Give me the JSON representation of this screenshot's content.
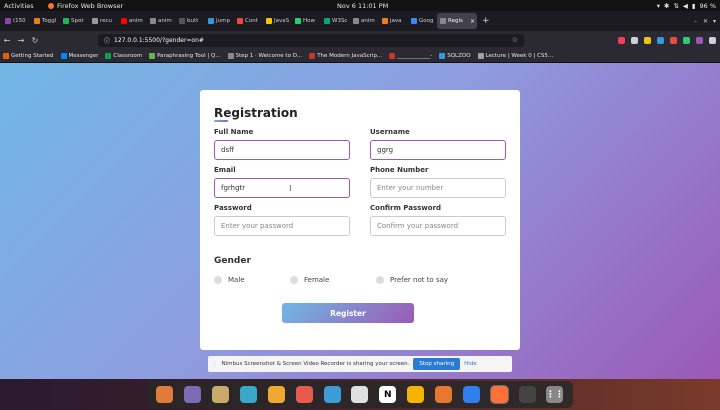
{
  "system_bar": {
    "activities": "Activities",
    "app_name": "Firefox Web Browser",
    "clock": "Nov 6  11:01 PM",
    "battery": "96 %"
  },
  "tabs": [
    {
      "label": "(150",
      "color": "#8e44ad"
    },
    {
      "label": "Toggl",
      "color": "#e67e22"
    },
    {
      "label": "Spot",
      "color": "#1db954"
    },
    {
      "label": "recu",
      "color": "#999999"
    },
    {
      "label": "anim",
      "color": "#ff0000"
    },
    {
      "label": "anim",
      "color": "#888888"
    },
    {
      "label": "butt",
      "color": "#555555"
    },
    {
      "label": "Jump",
      "color": "#3498db"
    },
    {
      "label": "Cont",
      "color": "#e74c3c"
    },
    {
      "label": "JavaS",
      "color": "#f1c40f"
    },
    {
      "label": "How",
      "color": "#2ecc71"
    },
    {
      "label": "W3Sc",
      "color": "#04aa6d"
    },
    {
      "label": "anim",
      "color": "#888888"
    },
    {
      "label": "java",
      "color": "#e67e22"
    },
    {
      "label": "Goog",
      "color": "#4285f4"
    }
  ],
  "active_tab": {
    "label": "Regis",
    "close": "×"
  },
  "url": "127.0.0.1:5500/?gender=on#",
  "bookmarks": [
    {
      "label": "Getting Started",
      "color": "#e66000"
    },
    {
      "label": "Messenger",
      "color": "#0084ff"
    },
    {
      "label": "Classroom",
      "color": "#0f9d58"
    },
    {
      "label": "Paraphrasing Tool | Q...",
      "color": "#6ab04c"
    },
    {
      "label": "Step 1 · Welcome to D...",
      "color": "#888888"
    },
    {
      "label": "The Modern JavaScrip...",
      "color": "#c0392b"
    },
    {
      "label": "____________-",
      "color": "#c0392b"
    },
    {
      "label": "SQLZOO",
      "color": "#3498db"
    },
    {
      "label": "Lecture | Week 0 | CS5...",
      "color": "#a0a0a0"
    }
  ],
  "form": {
    "title": "Registration",
    "full_name": {
      "label": "Full Name",
      "value": "dsff"
    },
    "username": {
      "label": "Username",
      "value": "ggrg"
    },
    "email": {
      "label": "Email",
      "value": "fgrhgtr"
    },
    "phone": {
      "label": "Phone Number",
      "placeholder": "Enter your number"
    },
    "password": {
      "label": "Password",
      "placeholder": "Enter your password"
    },
    "confirm_password": {
      "label": "Confirm Password",
      "placeholder": "Confirm your password"
    },
    "gender_title": "Gender",
    "gender_options": [
      "Male",
      "Female",
      "Prefer not to say"
    ],
    "register_label": "Register"
  },
  "share_notice": {
    "text": "Nimbus Screenshot & Screen Video Recorder is sharing your screen.",
    "stop": "Stop sharing",
    "hide": "Hide"
  },
  "dock": [
    {
      "icon": "screenshot-app-icon",
      "color": "#e07b39"
    },
    {
      "icon": "files-icon",
      "color": "#7d6bb5"
    },
    {
      "icon": "archive-icon",
      "color": "#c8a86b"
    },
    {
      "icon": "text-editor-icon",
      "color": "#3aa7c9"
    },
    {
      "icon": "settings-icon",
      "color": "#f0a830"
    },
    {
      "icon": "draw-icon",
      "color": "#e85b4a"
    },
    {
      "icon": "help-icon",
      "color": "#3d9bd6"
    },
    {
      "icon": "inkscape-icon",
      "color": "#e0e0e0"
    },
    {
      "icon": "notion-icon",
      "color": "#ffffff"
    },
    {
      "icon": "chrome-icon",
      "color": "#f4b400"
    },
    {
      "icon": "gallery-icon",
      "color": "#e8772e"
    },
    {
      "icon": "vscode-icon",
      "color": "#2f80ed"
    },
    {
      "icon": "firefox-icon",
      "color": "#ff7139"
    },
    {
      "icon": "obs-icon",
      "color": "#444444"
    },
    {
      "icon": "app-grid-icon",
      "color": "#888888"
    }
  ]
}
